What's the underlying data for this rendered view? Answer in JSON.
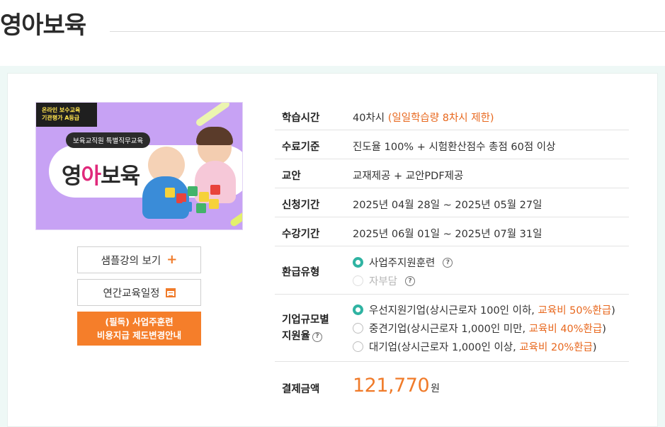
{
  "page": {
    "title": "영아보육"
  },
  "thumbnail": {
    "ribbon_line1": "온라인 보수교육",
    "ribbon_line2": "기관평가 A등급",
    "badge": "보육교직원 특별직무교육",
    "logo_part1": "영",
    "logo_part2": "아",
    "logo_part3": "보육"
  },
  "buttons": {
    "sample_label": "샘플강의 보기",
    "sample_icon": "plus-icon",
    "schedule_label": "연간교육일정",
    "schedule_icon": "calendar-icon",
    "notice_line1": "(필독) 사업주훈련",
    "notice_line2": "비용지급 제도변경안내"
  },
  "info": {
    "study_time": {
      "label": "학습시간",
      "value": "40차시",
      "note": "(일일학습량 8차시 제한)"
    },
    "completion": {
      "label": "수료기준",
      "value": "진도율 100% + 시험환산점수 총점 60점 이상"
    },
    "textbook": {
      "label": "교안",
      "value": "교재제공 + 교안PDF제공"
    },
    "apply_period": {
      "label": "신청기간",
      "value": "2025년 04월 28일 ~ 2025년 05월 27일"
    },
    "course_period": {
      "label": "수강기간",
      "value": "2025년 06월 01일 ~ 2025년 07월 31일"
    },
    "refund_type": {
      "label": "환급유형",
      "options": [
        {
          "label": "사업주지원훈련",
          "selected": true,
          "disabled": false
        },
        {
          "label": "자부담",
          "selected": false,
          "disabled": true
        }
      ]
    },
    "company_rate": {
      "label_line1": "기업규모별",
      "label_line2": "지원율",
      "options": [
        {
          "prefix": "우선지원기업(상시근로자 100인 이하, ",
          "highlight": "교육비 50%환급",
          "suffix": ")",
          "selected": true
        },
        {
          "prefix": "중견기업(상시근로자 1,000인 미만, ",
          "highlight": "교육비 40%환급",
          "suffix": ")",
          "selected": false
        },
        {
          "prefix": "대기업(상시근로자 1,000인 이상, ",
          "highlight": "교육비 20%환급",
          "suffix": ")",
          "selected": false
        }
      ]
    },
    "payment": {
      "label": "결제금액",
      "amount": "121,770",
      "unit": "원"
    }
  },
  "colors": {
    "accent_orange": "#f07b2a",
    "radio_teal": "#2fb3a2",
    "thumb_purple": "#c7a2f4",
    "panel_bg": "#eef8f6"
  }
}
